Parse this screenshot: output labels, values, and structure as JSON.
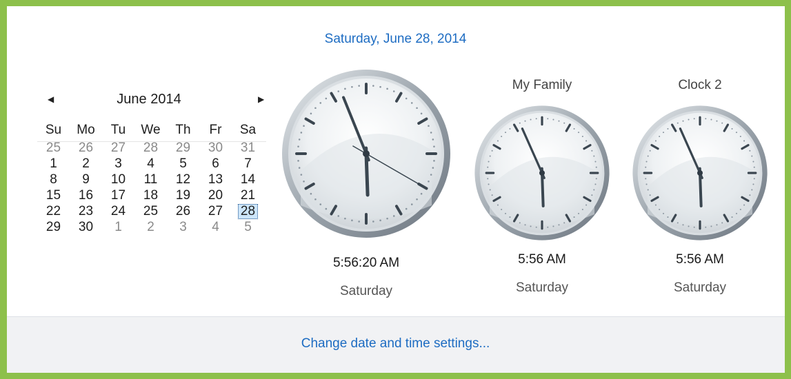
{
  "header": {
    "full_date": "Saturday, June 28, 2014"
  },
  "calendar": {
    "prev_icon": "triangle-left-icon",
    "next_icon": "triangle-right-icon",
    "month_title": "June 2014",
    "weekdays": [
      "Su",
      "Mo",
      "Tu",
      "We",
      "Th",
      "Fr",
      "Sa"
    ],
    "weeks": [
      [
        "25",
        "26",
        "27",
        "28",
        "29",
        "30",
        "31"
      ],
      [
        "1",
        "2",
        "3",
        "4",
        "5",
        "6",
        "7"
      ],
      [
        "8",
        "9",
        "10",
        "11",
        "12",
        "13",
        "14"
      ],
      [
        "15",
        "16",
        "17",
        "18",
        "19",
        "20",
        "21"
      ],
      [
        "22",
        "23",
        "24",
        "25",
        "26",
        "27",
        "28"
      ],
      [
        "29",
        "30",
        "1",
        "2",
        "3",
        "4",
        "5"
      ]
    ],
    "selected": "28"
  },
  "clocks": [
    {
      "label": "",
      "time": "5:56:20 AM",
      "day": "Saturday",
      "hours": 5,
      "minutes": 56,
      "seconds": 20
    },
    {
      "label": "My Family",
      "time": "5:56 AM",
      "day": "Saturday",
      "hours": 5,
      "minutes": 56
    },
    {
      "label": "Clock 2",
      "time": "5:56 AM",
      "day": "Saturday",
      "hours": 5,
      "minutes": 56
    }
  ],
  "footer": {
    "link": "Change date and time settings..."
  },
  "colors": {
    "accent": "#1d6cc2",
    "frame": "#8dc04b",
    "selected_bg": "#cde6fb"
  }
}
